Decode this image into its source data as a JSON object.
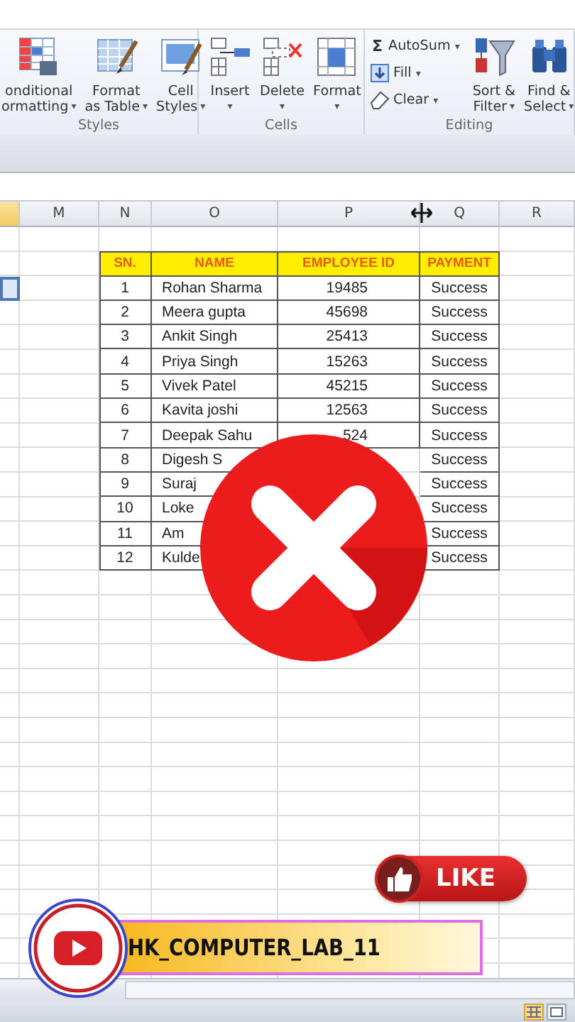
{
  "ribbon": {
    "groups": [
      {
        "label": "Styles",
        "kind": "large",
        "buttons": [
          {
            "lines": [
              "onditional",
              "ormatting"
            ],
            "caret": "▾"
          },
          {
            "lines": [
              "Format",
              "as Table"
            ],
            "caret": "▾"
          },
          {
            "lines": [
              "Cell",
              "Styles"
            ],
            "caret": "▾"
          }
        ]
      },
      {
        "label": "Cells",
        "kind": "large",
        "buttons": [
          {
            "lines": [
              "Insert"
            ],
            "caret": "▾"
          },
          {
            "lines": [
              "Delete"
            ],
            "caret": "▾"
          },
          {
            "lines": [
              "Format"
            ],
            "caret": "▾"
          }
        ]
      },
      {
        "label": "Editing",
        "kind": "mixed",
        "small": [
          {
            "symbol": "Σ",
            "label": "AutoSum",
            "caret": "▾"
          },
          {
            "label": "Fill",
            "caret": "▾"
          },
          {
            "label": "Clear",
            "caret": "▾"
          }
        ],
        "buttons": [
          {
            "lines": [
              "Sort &",
              "Filter"
            ],
            "caret": "▾"
          },
          {
            "lines": [
              "Find &",
              "Select"
            ],
            "caret": "▾"
          }
        ]
      }
    ]
  },
  "sheet": {
    "columns": [
      {
        "selected": true
      },
      {
        "label": "M",
        "selected": false
      },
      {
        "label": "N",
        "selected": false
      },
      {
        "label": "O",
        "selected": false
      },
      {
        "label": "P",
        "selected": false
      },
      {
        "label": "Q",
        "selected": false
      },
      {
        "label": "R",
        "selected": false
      }
    ],
    "active_cell": {
      "shown": true
    },
    "table": {
      "headers": [
        "SN.",
        "NAME",
        "EMPLOYEE ID",
        "PAYMENT"
      ],
      "rows": [
        [
          "1",
          "Rohan Sharma",
          "19485",
          "Success"
        ],
        [
          "2",
          "Meera gupta",
          "45698",
          "Success"
        ],
        [
          "3",
          "Ankit Singh",
          "25413",
          "Success"
        ],
        [
          "4",
          "Priya Singh",
          "15263",
          "Success"
        ],
        [
          "5",
          "Vivek Patel",
          "45215",
          "Success"
        ],
        [
          "6",
          "Kavita joshi",
          "12563",
          "Success"
        ],
        [
          "7",
          "Deepak Sahu",
          "524",
          "Success"
        ],
        [
          "8",
          "Digesh S",
          null,
          "Success"
        ],
        [
          "9",
          "Suraj",
          null,
          "Success"
        ],
        [
          "10",
          "Loke",
          null,
          "Success"
        ],
        [
          "11",
          "Am",
          null,
          "Success"
        ],
        [
          "12",
          "Kulde",
          null,
          "Success"
        ]
      ]
    }
  },
  "like_badge": {
    "label": "LIKE"
  },
  "channel_banner": {
    "name": "HK_COMPUTER_LAB_11"
  },
  "status_bar": {
    "views": [
      {
        "selected": true
      },
      {
        "selected": false
      }
    ]
  }
}
